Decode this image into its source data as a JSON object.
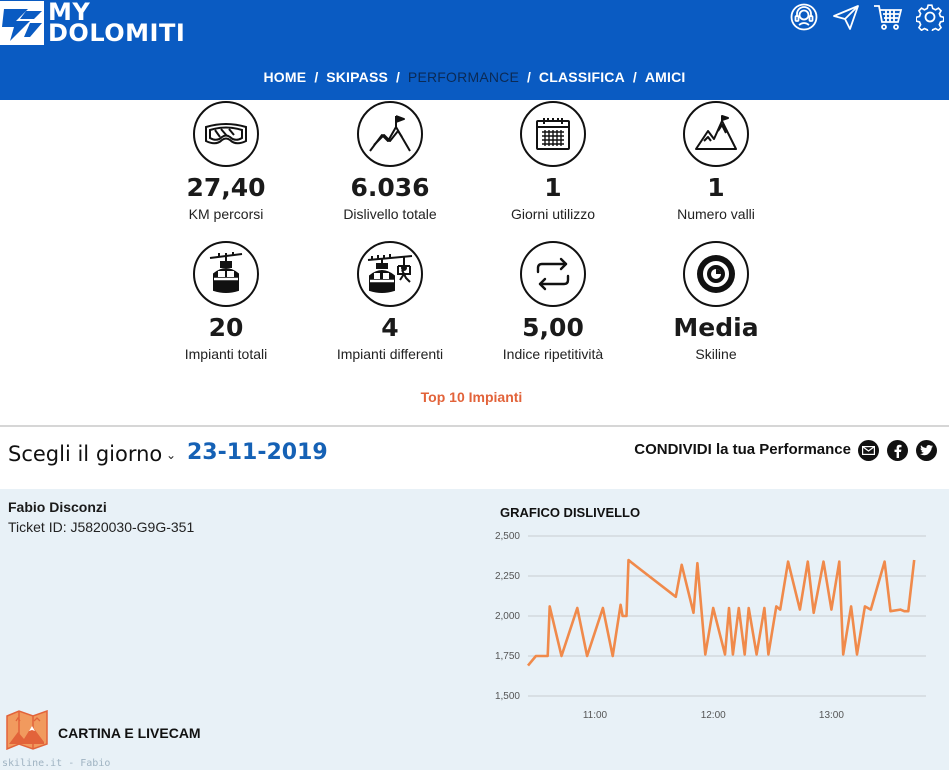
{
  "header": {
    "logo_line1": "MY",
    "logo_line2": "DOLOMITI",
    "icons": [
      "support-icon",
      "send-icon",
      "cart-icon",
      "settings-icon"
    ],
    "nav": [
      {
        "label": "HOME",
        "active": false
      },
      {
        "label": "SKIPASS",
        "active": false
      },
      {
        "label": "PERFORMANCE",
        "active": true
      },
      {
        "label": "CLASSIFICA",
        "active": false
      },
      {
        "label": "AMICI",
        "active": false
      }
    ],
    "nav_separator": "/"
  },
  "stats": [
    {
      "icon": "ski-goggles-icon",
      "value": "27,40",
      "label": "KM percorsi"
    },
    {
      "icon": "summit-flag-icon",
      "value": "6.036",
      "label": "Dislivello totale"
    },
    {
      "icon": "calendar-icon",
      "value": "1",
      "label": "Giorni utilizzo"
    },
    {
      "icon": "mountain-icon",
      "value": "1",
      "label": "Numero valli"
    },
    {
      "icon": "gondola-icon",
      "value": "20",
      "label": "Impianti totali"
    },
    {
      "icon": "chairlift-icon",
      "value": "4",
      "label": "Impianti differenti"
    },
    {
      "icon": "repeat-icon",
      "value": "5,00",
      "label": "Indice ripetitività"
    },
    {
      "icon": "skiline-icon",
      "value": "Media",
      "label": "Skiline"
    }
  ],
  "top10_link": "Top 10 Impianti",
  "day": {
    "label": "Scegli il giorno",
    "chevron": "⌄",
    "date": "23-11-2019"
  },
  "share": {
    "label": "CONDIVIDI la tua Performance",
    "icons": [
      "email-icon",
      "facebook-icon",
      "twitter-icon"
    ]
  },
  "user": {
    "name": "Fabio Disconzi",
    "ticket": "Ticket ID: J5820030-G9G-351"
  },
  "map_link": "CARTINA E LIVECAM",
  "watermark": "skiline.it - Fabio",
  "colors": {
    "header_bg": "#0a5bc2",
    "accent_orange": "#e2633a",
    "date_blue": "#1561b5",
    "panel_bg": "#e8f1f7",
    "line": "#f08a4b"
  },
  "chart_data": {
    "type": "line",
    "title": "GRAFICO DISLIVELLO",
    "xlabel": "",
    "ylabel": "",
    "ylim": [
      1500,
      2500
    ],
    "yticks": [
      2500,
      2250,
      2000,
      1750,
      1500
    ],
    "ytick_labels": [
      "2,500",
      "2,250",
      "2,000",
      "1,750",
      "1,500"
    ],
    "xlim": [
      "10:26",
      "13:48"
    ],
    "xticks": [
      "11:00",
      "12:00",
      "13:00"
    ],
    "grid": true,
    "series": [
      {
        "x": [
          "10:26",
          "10:30",
          "10:36",
          "10:37",
          "10:43",
          "10:51",
          "10:56",
          "11:04",
          "11:09",
          "11:13",
          "11:14",
          "11:16",
          "11:17",
          "11:19",
          "11:41",
          "11:44",
          "11:50",
          "11:52",
          "11:56",
          "12:00",
          "12:06",
          "12:08",
          "12:10",
          "12:13",
          "12:16",
          "12:18",
          "12:22",
          "12:26",
          "12:28",
          "12:32",
          "12:34",
          "12:38",
          "12:44",
          "12:48",
          "12:51",
          "12:56",
          "13:00",
          "13:04",
          "13:06",
          "13:10",
          "13:13",
          "13:17",
          "13:20",
          "13:27",
          "13:30",
          "13:35",
          "13:37",
          "13:39",
          "13:42"
        ],
        "y": [
          1690,
          1750,
          1750,
          2060,
          1750,
          2050,
          1750,
          2050,
          1750,
          2070,
          2000,
          2000,
          2350,
          2330,
          2120,
          2320,
          2020,
          2330,
          1760,
          2050,
          1760,
          2050,
          1760,
          2050,
          1760,
          2050,
          1760,
          2050,
          1760,
          2060,
          2040,
          2340,
          2040,
          2340,
          2020,
          2340,
          2040,
          2340,
          1760,
          2060,
          1760,
          2060,
          2040,
          2340,
          2030,
          2040,
          2030,
          2030,
          2350
        ]
      }
    ]
  }
}
